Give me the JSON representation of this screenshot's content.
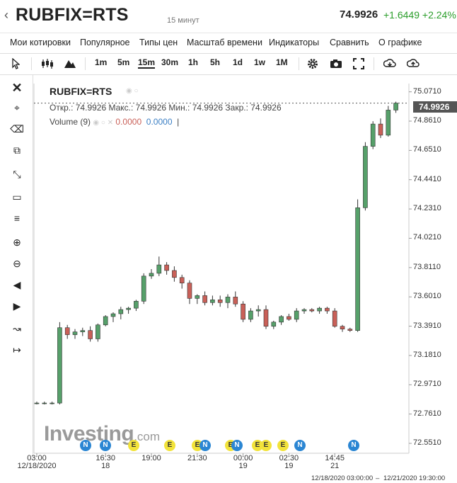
{
  "header": {
    "back_icon": "chevron-left-icon",
    "symbol": "RUBFIX=RTS",
    "period": "15 минут",
    "price": "74.9926",
    "change": "+1.6449",
    "change_pct": "+2.24%",
    "change_color": "#2a9d2a"
  },
  "menu": [
    "Мои котировки",
    "Популярное",
    "Типы цен",
    "Масштаб времени",
    "Индикаторы",
    "Сравнить",
    "О графике"
  ],
  "toolbar": {
    "cursor_icon": "cursor-icon",
    "candles_icon": "candles-icon",
    "mountain_icon": "mountain-icon",
    "intervals": [
      "1m",
      "5m",
      "15m",
      "30m",
      "1h",
      "5h",
      "1d",
      "1w",
      "1M"
    ],
    "active_interval": "15m",
    "right_icons": [
      "gear-icon",
      "camera-icon",
      "fullscreen-icon",
      "download-icon",
      "upload-icon"
    ]
  },
  "side_tools": [
    "close-icon",
    "crosshair-icon",
    "delete-drawings-icon",
    "copy-icon",
    "trendline-icon",
    "rectangle-icon",
    "fibonacci-icon",
    "zoom-in-icon",
    "zoom-out-icon",
    "scroll-left-icon",
    "scroll-right-icon",
    "magnet-icon",
    "measure-icon"
  ],
  "legend": {
    "symbol": "RUBFIX=RTS",
    "ohlc": "Откр.: 74.9926 Макс.: 74.9926 Мин.: 74.9926 Закр.: 74.9926",
    "volume_label": "Volume (9)",
    "volume_val1": "0.0000",
    "volume_val2": "0.0000",
    "volume_sep": "|"
  },
  "price_tag": "74.9926",
  "watermark": {
    "main": "Investing",
    "suffix": ".com"
  },
  "footer": {
    "range_start": "12/18/2020 03:00:00",
    "dash": "–",
    "range_end": "12/21/2020 19:30:00"
  },
  "events": [
    "N",
    "N",
    "E",
    "E",
    "E",
    "N",
    "E",
    "N",
    "E",
    "E",
    "E",
    "N",
    "N"
  ],
  "chart_data": {
    "type": "candlestick",
    "yticks": [
      "75.0710",
      "74.8610",
      "74.6510",
      "74.4410",
      "74.2310",
      "74.0210",
      "73.8110",
      "73.6010",
      "73.3910",
      "73.1810",
      "72.9710",
      "72.7610",
      "72.5510"
    ],
    "ylim": [
      72.48,
      75.13
    ],
    "xticks": [
      {
        "label": "03:00",
        "sub": "12/18/2020",
        "i": 0
      },
      {
        "label": "16:30",
        "sub": "18",
        "i": 9
      },
      {
        "label": "19:00",
        "sub": "",
        "i": 15
      },
      {
        "label": "21:30",
        "sub": "",
        "i": 21
      },
      {
        "label": "00:00",
        "sub": "19",
        "i": 27
      },
      {
        "label": "02:30",
        "sub": "19",
        "i": 33
      },
      {
        "label": "14:45",
        "sub": "21",
        "i": 39
      }
    ],
    "colors": {
      "up": "#56a06a",
      "down": "#c96058"
    },
    "candles": [
      [
        72.84,
        72.85,
        72.83,
        72.84
      ],
      [
        72.84,
        72.85,
        72.83,
        72.84
      ],
      [
        72.84,
        72.85,
        72.83,
        72.84
      ],
      [
        72.84,
        73.42,
        72.83,
        73.38
      ],
      [
        73.38,
        73.4,
        73.3,
        73.33
      ],
      [
        73.33,
        73.37,
        73.3,
        73.35
      ],
      [
        73.35,
        73.38,
        73.32,
        73.36
      ],
      [
        73.36,
        73.39,
        73.28,
        73.3
      ],
      [
        73.3,
        73.41,
        73.28,
        73.4
      ],
      [
        73.4,
        73.47,
        73.39,
        73.46
      ],
      [
        73.46,
        73.49,
        73.42,
        73.48
      ],
      [
        73.48,
        73.53,
        73.44,
        73.51
      ],
      [
        73.51,
        73.53,
        73.48,
        73.52
      ],
      [
        73.52,
        73.58,
        73.5,
        73.57
      ],
      [
        73.57,
        73.77,
        73.55,
        73.75
      ],
      [
        73.75,
        73.8,
        73.73,
        73.77
      ],
      [
        73.77,
        73.89,
        73.75,
        73.83
      ],
      [
        73.83,
        73.85,
        73.76,
        73.79
      ],
      [
        73.79,
        73.82,
        73.71,
        73.74
      ],
      [
        73.74,
        73.76,
        73.66,
        73.7
      ],
      [
        73.7,
        73.72,
        73.55,
        73.59
      ],
      [
        73.59,
        73.62,
        73.55,
        73.61
      ],
      [
        73.61,
        73.64,
        73.54,
        73.56
      ],
      [
        73.56,
        73.61,
        73.54,
        73.58
      ],
      [
        73.58,
        73.61,
        73.53,
        73.56
      ],
      [
        73.56,
        73.62,
        73.52,
        73.6
      ],
      [
        73.6,
        73.64,
        73.53,
        73.55
      ],
      [
        73.55,
        73.57,
        73.42,
        73.44
      ],
      [
        73.44,
        73.52,
        73.42,
        73.5
      ],
      [
        73.5,
        73.54,
        73.46,
        73.51
      ],
      [
        73.51,
        73.54,
        73.37,
        73.39
      ],
      [
        73.39,
        73.43,
        73.37,
        73.42
      ],
      [
        73.42,
        73.47,
        73.4,
        73.46
      ],
      [
        73.46,
        73.48,
        73.43,
        73.44
      ],
      [
        73.44,
        73.52,
        73.42,
        73.5
      ],
      [
        73.5,
        73.52,
        73.48,
        73.51
      ],
      [
        73.51,
        73.52,
        73.49,
        73.5
      ],
      [
        73.5,
        73.53,
        73.48,
        73.52
      ],
      [
        73.52,
        73.53,
        73.48,
        73.5
      ],
      [
        73.5,
        73.52,
        73.38,
        73.39
      ],
      [
        73.39,
        73.4,
        73.35,
        73.37
      ],
      [
        73.37,
        73.38,
        73.35,
        73.36
      ],
      [
        73.36,
        74.3,
        73.35,
        74.24
      ],
      [
        74.24,
        74.71,
        74.22,
        74.68
      ],
      [
        74.68,
        74.86,
        74.66,
        74.84
      ],
      [
        74.84,
        74.88,
        74.74,
        74.76
      ],
      [
        74.76,
        74.97,
        74.75,
        74.94
      ],
      [
        74.94,
        75.0,
        74.92,
        74.99
      ]
    ]
  }
}
